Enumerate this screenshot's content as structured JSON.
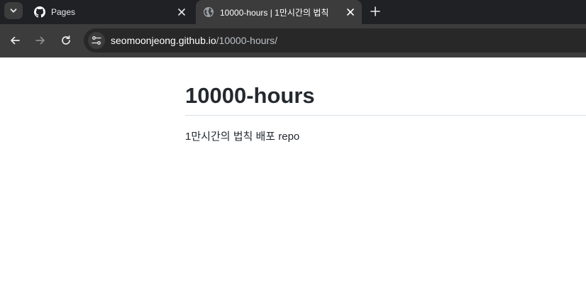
{
  "browser": {
    "tabs": [
      {
        "title": "Pages",
        "favicon": "github-icon",
        "active": false
      },
      {
        "title": "10000-hours | 1만시간의 법칙",
        "favicon": "globe-icon",
        "active": true
      }
    ],
    "address_bar": {
      "url_host": "seomoonjeong.github.io",
      "url_path": "/10000-hours/"
    },
    "colors": {
      "frame": "#202124",
      "toolbar": "#3c3c3c",
      "omnibox": "#282828"
    }
  },
  "page": {
    "title": "10000-hours",
    "description": "1만시간의 법칙 배포 repo"
  }
}
